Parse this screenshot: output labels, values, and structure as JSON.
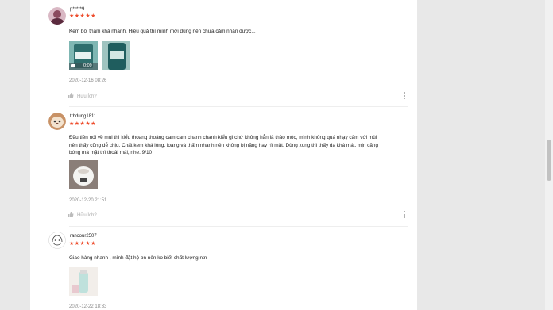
{
  "reviews": [
    {
      "username": "p*****9",
      "stars": "★★★★★",
      "comment": "Kem bôi thấm khá nhanh. Hiệu quả thì mình mới dùng nên chưa cảm nhận được...",
      "video_duration": "0:09",
      "time": "2020-12-16 08:26",
      "helpful": "Hữu Ích?"
    },
    {
      "username": "trhdung1811",
      "stars": "★★★★★",
      "comment": "Đầu tiên nói về mùi thì kiểu thoang thoảng cam cam chanh chanh kiểu gì chứ không hẳn là thảo mộc, mình không quá nhạy cảm với mùi nên thấy cũng dễ chịu. Chất kem khá lỏng, loạng và thấm nhanh nên không bị nặng hay rít mặt. Dùng xong thì thấy da khá mát, mịn căng bóng mà mặt thì thoải mái, nhe. 9/10",
      "time": "2020-12-20 21:51",
      "helpful": "Hữu Ích?"
    },
    {
      "username": "rancour2507",
      "stars": "★★★★★",
      "comment": "Giao hàng nhanh , mình đặt hộ bn nên ko biết chất lượng ntn",
      "time": "2020-12-22 18:33"
    }
  ],
  "colors": {
    "star": "#ee4d2d",
    "background": "#e8e8e8",
    "panel": "#ffffff"
  }
}
